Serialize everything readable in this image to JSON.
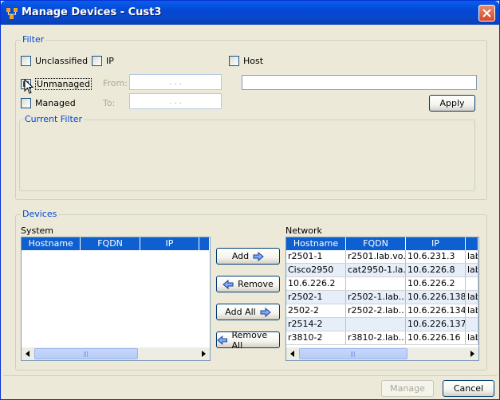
{
  "window": {
    "title": "Manage Devices - Cust3"
  },
  "filter": {
    "legend": "Filter",
    "unclassified_label": "Unclassified",
    "ip_label": "IP",
    "host_label": "Host",
    "unmanaged_label": "Unmanaged",
    "managed_label": "Managed",
    "from_label": "From:",
    "to_label": "To:",
    "ip_placeholder": ".   .   .",
    "apply_label": "Apply",
    "current_filter_legend": "Current Filter",
    "unmanaged_checked": true
  },
  "devices": {
    "legend": "Devices",
    "system_label": "System",
    "network_label": "Network",
    "system_columns": [
      "Hostname",
      "FQDN",
      "IP"
    ],
    "network_columns": [
      "Hostname",
      "FQDN",
      "IP"
    ],
    "network_rows": [
      [
        "r2501-1",
        "r2501.lab.vo...",
        "10.6.231.3",
        "lab"
      ],
      [
        "Cisco2950",
        "cat2950-1.la...",
        "10.6.226.8",
        "lab"
      ],
      [
        "10.6.226.2",
        "",
        "10.6.226.2",
        ""
      ],
      [
        "r2502-1",
        "r2502-1.lab....",
        "10.6.226.138",
        "lab"
      ],
      [
        "2502-2",
        "r2502-2.lab....",
        "10.6.226.134",
        "lab"
      ],
      [
        "r2514-2",
        "",
        "10.6.226.137",
        ""
      ],
      [
        "r3810-2",
        "r3810-2.lab....",
        "10.6.226.16",
        "lab"
      ]
    ],
    "add_label": "Add",
    "remove_label": "Remove",
    "add_all_label": "Add All",
    "remove_all_label": "Remove All"
  },
  "footer": {
    "manage_label": "Manage",
    "cancel_label": "Cancel"
  },
  "colors": {
    "title_bar": "#0a5ee9",
    "header": "#0e5fcf",
    "legend": "#0046d5"
  }
}
